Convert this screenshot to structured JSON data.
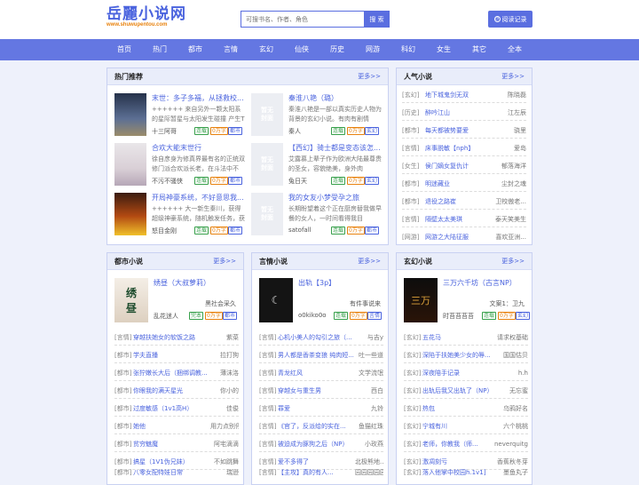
{
  "header": {
    "logo": "岳麗小说网",
    "url": "www.shuwupentou.com",
    "search_placeholder": "可搜书名、作者、角色",
    "search_button": "搜 索",
    "history_button": "阅读记录"
  },
  "nav": [
    "首页",
    "热门",
    "都市",
    "言情",
    "玄幻",
    "仙侠",
    "历史",
    "网游",
    "科幻",
    "女生",
    "其它",
    "全本"
  ],
  "hot": {
    "title": "热门推荐",
    "more": "更多>>",
    "books": [
      {
        "title": "末世：多子多福，从拯救校...",
        "desc": "++++++ 来自另外一颗太阳系的星际暂星与太阳发生碰撞 产生T时十三阿哥",
        "author": "十三阿哥",
        "tags": [
          "连载",
          "都市"
        ]
      },
      {
        "title": "秦淮八艳（璐）",
        "desc": "秦淮八艳是一部以真实历史人物为背景的玄幻小说。有肉有剧情",
        "author": "秦人",
        "tags": [
          "连载",
          "玄幻"
        ]
      },
      {
        "title": "合欢大能末世行",
        "desc": "徐自彦身为修真界最有名的正统双修门派合欢派长老，在斗法中不",
        "author": "不污不骚侠",
        "tags": [
          "连载",
          "都市"
        ]
      },
      {
        "title": "【西幻】骑士都是变态该怎...",
        "desc": "艾露慕上辈子作为欧洲大陆最尊贵的圣女，容貌绝美，身外肉",
        "author": "兔日天",
        "tags": [
          "连载",
          "玄幻"
        ]
      },
      {
        "title": "开局神豪系统，不好意思我...",
        "desc": "++++++ 大一新生秦川，获得超级神豪系统，随机触发任务，获",
        "author": "怒目金刚",
        "tags": [
          "连载",
          "都市"
        ]
      },
      {
        "title": "我的女友小梦受孕之旅",
        "desc": "长期盼望着这个正在厨房替我做早餐的女人，一时间看得我目",
        "author": "satofall",
        "tags": [
          "连载",
          "都市"
        ]
      }
    ],
    "placeholder_text": "暂无\n封面"
  },
  "popular": {
    "title": "人气小说",
    "more": "更多>>",
    "items": [
      {
        "cat": "[玄幻]",
        "title": "地下城鬼剑无双",
        "author": "陈晓磊"
      },
      {
        "cat": "[历史]",
        "title": "醉吟江山",
        "author": "江左辰"
      },
      {
        "cat": "[都市]",
        "title": "每天都被势要爱",
        "author": "骁里"
      },
      {
        "cat": "[言情]",
        "title": "床事脱敏【nph】",
        "author": "爱岛"
      },
      {
        "cat": "[女生]",
        "title": "侯门嫡女复仇计",
        "author": "郁落海洋"
      },
      {
        "cat": "[都市]",
        "title": "明迷藏业",
        "author": "尘封之魂"
      },
      {
        "cat": "[都市]",
        "title": "退役之路崔",
        "author": "卫校傲老..."
      },
      {
        "cat": "[言情]",
        "title": "隔壁太太美琪",
        "author": "泰天笑美生"
      },
      {
        "cat": "[网游]",
        "title": "网游之大陆征服",
        "author": "喜欢亚洲..."
      }
    ]
  },
  "urban": {
    "title": "都市小说",
    "more": "更多>>",
    "feature": {
      "title": "绣昼（大叔萝莉）",
      "line1": "黑社会采久",
      "author": "乱花迷人",
      "tags": [
        "完本",
        "都市"
      ],
      "cover": "绣\n昼"
    },
    "items": [
      {
        "cat": "[言情]",
        "title": "穿越扶她女的软饭之路",
        "author": "紫菜"
      },
      {
        "cat": "[都市]",
        "title": "学夫直播",
        "author": "拉打狗"
      },
      {
        "cat": "[都市]",
        "title": "张狞嫩长大后（捆绑调教...",
        "author": "薄沫洛"
      },
      {
        "cat": "[都市]",
        "title": "你眼我的满天星光",
        "author": "你小的"
      },
      {
        "cat": "[都市]",
        "title": "过度敏感（1v1高H）",
        "author": "佳俊"
      },
      {
        "cat": "[都市]",
        "title": "她他",
        "author": "用力点别停"
      },
      {
        "cat": "[都市]",
        "title": "贫穷魅魔",
        "author": "阿宅滴滴"
      },
      {
        "cat": "[都市]",
        "title": "搞星（1V1伪兄妹）",
        "author": "不如跳舞"
      },
      {
        "cat": "[都市]",
        "title": "八零女配特娃日常",
        "author": "瑞逊"
      }
    ]
  },
  "romance": {
    "title": "言情小说",
    "more": "更多>>",
    "feature": {
      "title": "出轨【3p】",
      "line1": "有件事说来",
      "author": "o0kiko0o",
      "tags": [
        "连载",
        "言情"
      ],
      "cover": "出\n轨"
    },
    "items": [
      {
        "cat": "[言情]",
        "title": "心机小美人的勾引之旅（...",
        "author": "与吉y"
      },
      {
        "cat": "[言情]",
        "title": "男人都是香茶变狼 纯肉短...",
        "author": "吐一些道"
      },
      {
        "cat": "[言情]",
        "title": "青龙红风",
        "author": "文学流氓"
      },
      {
        "cat": "[言情]",
        "title": "穿越女与重生男",
        "author": "西白"
      },
      {
        "cat": "[言情]",
        "title": "罪爱",
        "author": "九铃"
      },
      {
        "cat": "[言情]",
        "title": "《官了，反派给的实在...",
        "author": "鱼猫红珠"
      },
      {
        "cat": "[言情]",
        "title": "被迫成为豚狗之后（NP）",
        "author": "小玫燕"
      },
      {
        "cat": "[言情]",
        "title": "爱不多得了",
        "author": "北极熊地..."
      },
      {
        "cat": "[言情]",
        "title": "【主攻】真的有人...",
        "author": "园园园园园"
      }
    ]
  },
  "fantasy": {
    "title": "玄幻小说",
    "more": "更多>>",
    "feature": {
      "title": "三万六千坊（古言NP）",
      "line1": "文案1：卫九",
      "author": "时苔苔苔苔",
      "tags": [
        "连载",
        "玄幻"
      ],
      "cover": "三万\n六千坊"
    },
    "items": [
      {
        "cat": "[玄幻]",
        "title": "五花马",
        "author": "请求权基础"
      },
      {
        "cat": "[玄幻]",
        "title": "深陷于扶她美少女的辱...",
        "author": "国国估贝"
      },
      {
        "cat": "[玄幻]",
        "title": "深夜陪手记录",
        "author": "h.h"
      },
      {
        "cat": "[玄幻]",
        "title": "出轨后我又出轨了（NP）",
        "author": "无忘蜜"
      },
      {
        "cat": "[玄幻]",
        "title": "热包",
        "author": "乌鸦好名"
      },
      {
        "cat": "[玄幻]",
        "title": "宁城有川",
        "author": "六个桃桃"
      },
      {
        "cat": "[玄幻]",
        "title": "老师，你教我（师...",
        "author": "neverquitg..."
      },
      {
        "cat": "[玄幻]",
        "title": "激凋刻亏",
        "author": "香蕉秋冬芽"
      },
      {
        "cat": "[玄幻]",
        "title": "落入他掌中校园h.1v1]",
        "author": "墨鱼丸子"
      }
    ]
  }
}
